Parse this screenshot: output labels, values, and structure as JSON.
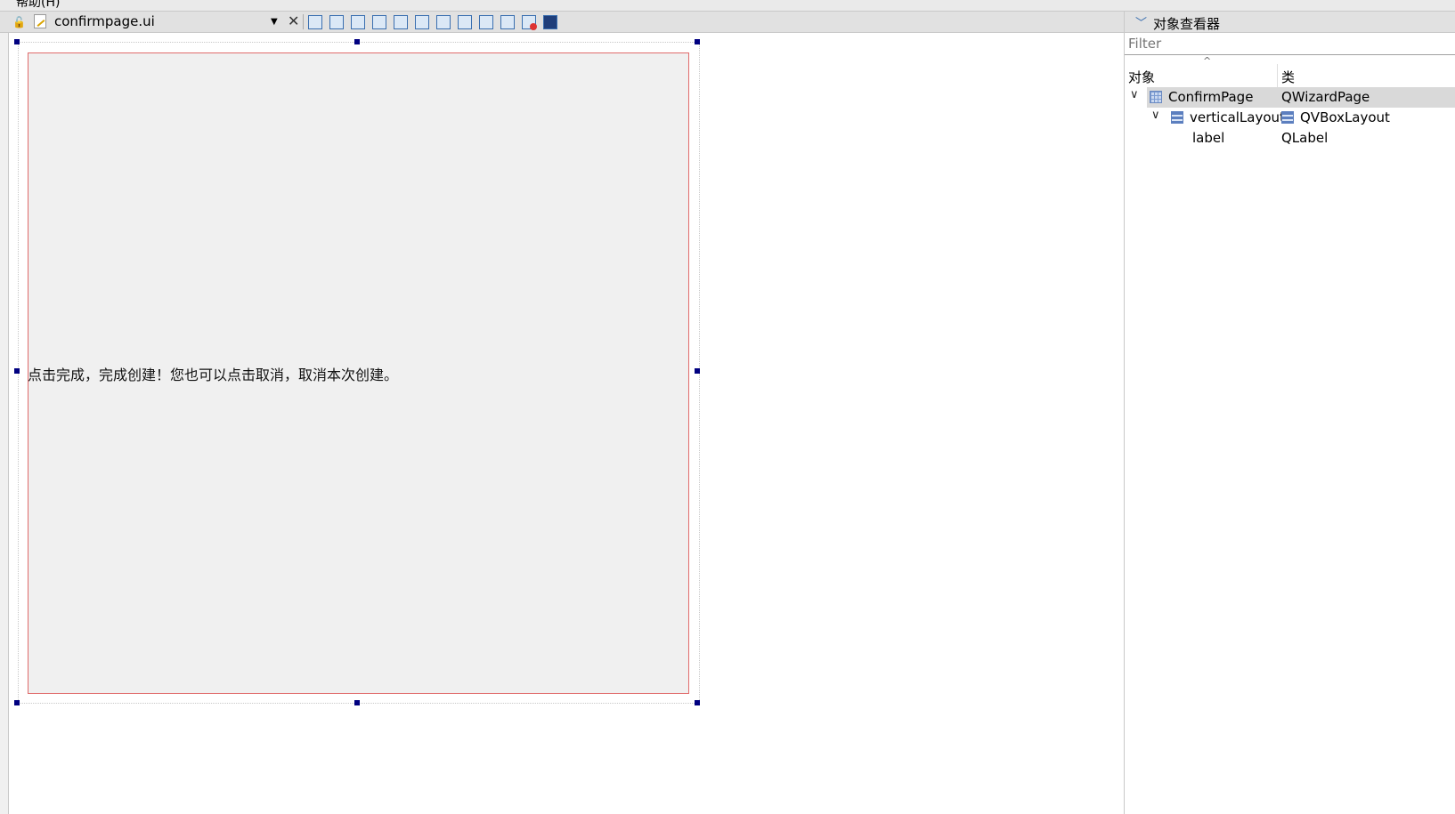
{
  "menubar": {
    "help_label": "帮助(H)"
  },
  "doc_toolbar": {
    "file_name": "confirmpage.ui"
  },
  "form": {
    "label_text": "点击完成，完成创建！您也可以点击取消，取消本次创建。"
  },
  "inspector": {
    "title": "对象查看器",
    "filter_placeholder": "Filter",
    "columns": {
      "object": "对象",
      "class": "类"
    },
    "rows": [
      {
        "name": "ConfirmPage",
        "class": "QWizardPage"
      },
      {
        "name": "verticalLayout",
        "class": "QVBoxLayout"
      },
      {
        "name": "label",
        "class": "QLabel"
      }
    ]
  },
  "icons": [
    "lock-icon",
    "file-edit-icon",
    "dropdown-arrow-icon",
    "close-icon",
    "chevron-down-icon",
    "wizard-page-icon",
    "vbox-layout-icon"
  ]
}
